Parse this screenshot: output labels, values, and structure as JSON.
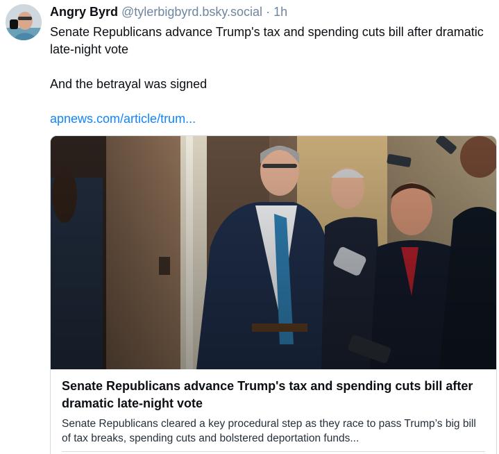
{
  "author": {
    "display_name": "Angry Byrd",
    "handle": "@tylerbigbyrd.bsky.social",
    "separator": "·",
    "time": "1h"
  },
  "post": {
    "line1": "Senate Republicans advance Trump's tax and spending cuts bill after dramatic late-night vote",
    "line2": "And the betrayal was signed",
    "link_text": "apnews.com/article/trum..."
  },
  "embed": {
    "title": "Senate Republicans advance Trump's tax and spending cuts bill after dramatic late-night vote",
    "description": "Senate Republicans cleared a key procedural step as they race to pass Trump’s big bill of tax breaks, spending cuts and bolstered deportation funds..."
  },
  "colors": {
    "link": "#1083fe",
    "muted": "#6f869f",
    "text": "#0b0f14",
    "border": "#d4dbe2"
  },
  "icons": {
    "avatar": "user-avatar-photo"
  }
}
